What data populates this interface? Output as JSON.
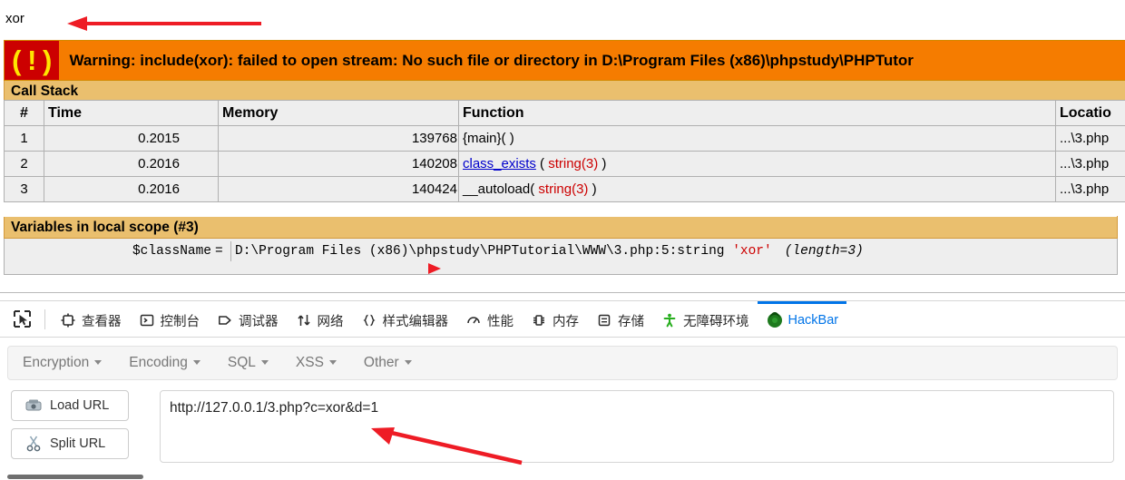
{
  "page": {
    "echo_output": "xor",
    "warning": {
      "icon_glyph": "( ! )",
      "text": "Warning: include(xor): failed to open stream: No such file or directory in D:\\Program Files (x86)\\phpstudy\\PHPTutor"
    },
    "call_stack": {
      "section_title": "Call Stack",
      "columns": [
        "#",
        "Time",
        "Memory",
        "Function",
        "Locatio"
      ],
      "rows": [
        {
          "num": "1",
          "time": "0.2015",
          "memory": "139768",
          "fn_link": "",
          "fn_pre": "{main}( )",
          "fn_arg": "",
          "fn_post": "",
          "location": "...\\3.php"
        },
        {
          "num": "2",
          "time": "0.2016",
          "memory": "140208",
          "fn_link": "class_exists",
          "fn_pre": " ( ",
          "fn_arg": "string(3)",
          "fn_post": " )",
          "location": "...\\3.php"
        },
        {
          "num": "3",
          "time": "0.2016",
          "memory": "140424",
          "fn_link": "",
          "fn_pre": "__autoload( ",
          "fn_arg": "string(3)",
          "fn_post": " )",
          "location": "...\\3.php"
        }
      ]
    },
    "variables": {
      "section_title": "Variables in local scope (#3)",
      "rows": [
        {
          "name": "$className",
          "equals": "=",
          "value_prefix": "D:\\Program Files (x86)\\phpstudy\\PHPTutorial\\WWW\\3.php:5:string ",
          "value_string": "'xor'",
          "value_length": "(length=3)"
        }
      ]
    }
  },
  "devtools": {
    "picker_icon": "element-picker-icon",
    "tabs": [
      {
        "label": "查看器",
        "icon": "inspector-icon",
        "active": false
      },
      {
        "label": "控制台",
        "icon": "console-icon",
        "active": false
      },
      {
        "label": "调试器",
        "icon": "debugger-icon",
        "active": false
      },
      {
        "label": "网络",
        "icon": "network-icon",
        "active": false
      },
      {
        "label": "样式编辑器",
        "icon": "style-editor-icon",
        "active": false
      },
      {
        "label": "性能",
        "icon": "performance-icon",
        "active": false
      },
      {
        "label": "内存",
        "icon": "memory-icon",
        "active": false
      },
      {
        "label": "存储",
        "icon": "storage-icon",
        "active": false
      },
      {
        "label": "无障碍环境",
        "icon": "accessibility-icon",
        "active": false
      },
      {
        "label": "HackBar",
        "icon": "hackbar-icon",
        "active": true
      }
    ]
  },
  "hackbar": {
    "menus": [
      {
        "label": "Encryption"
      },
      {
        "label": "Encoding"
      },
      {
        "label": "SQL"
      },
      {
        "label": "XSS"
      },
      {
        "label": "Other"
      }
    ],
    "buttons": [
      {
        "label": "Load URL",
        "icon": "load-url-icon"
      },
      {
        "label": "Split URL",
        "icon": "split-url-icon"
      }
    ],
    "url_value": "http://127.0.0.1/3.php?c=xor&d=1",
    "url_placeholder": ""
  },
  "colors": {
    "warning_bg": "#f57c00",
    "warning_icon_bg": "#cc0000",
    "warning_icon_fg": "#ffe600",
    "section_header_bg": "#eabf6e",
    "table_row_bg": "#eeeeee",
    "link": "#0000cc",
    "string_arg": "#cc0000",
    "active_tab": "#0074e8",
    "annotation_arrow": "#ee1c25"
  },
  "annotations": [
    {
      "name": "arrow-to-echo-output",
      "direction": "left"
    },
    {
      "name": "arrow-to-variable-path",
      "direction": "right-marker"
    },
    {
      "name": "arrow-to-url-bar",
      "direction": "up-left"
    }
  ]
}
